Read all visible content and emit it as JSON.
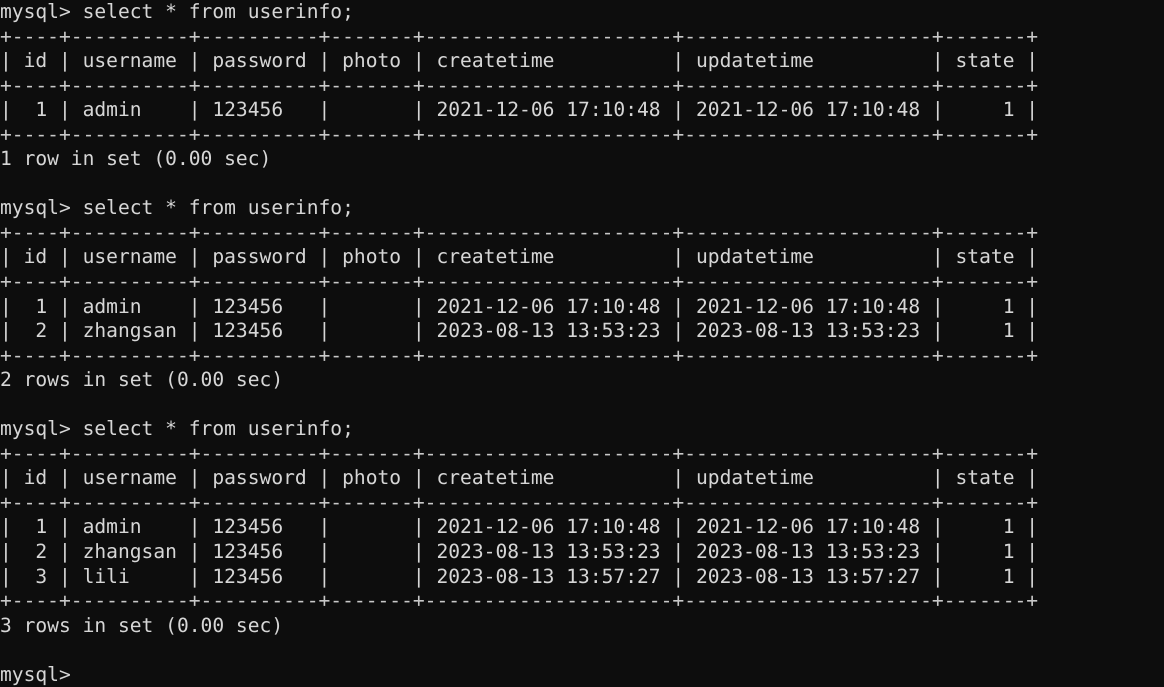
{
  "terminal": {
    "background_color": "#0d0d0d",
    "text_color": "#d6d6d6",
    "rule_color": "#c8c8c8",
    "prompt": "mysql>",
    "final_prompt": "mysql>"
  },
  "table": {
    "name": "userinfo",
    "columns": [
      {
        "label": "id",
        "width": 4,
        "align": "right"
      },
      {
        "label": "username",
        "width": 10,
        "align": "left"
      },
      {
        "label": "password",
        "width": 10,
        "align": "left"
      },
      {
        "label": "photo",
        "width": 7,
        "align": "left"
      },
      {
        "label": "createtime",
        "width": 21,
        "align": "left"
      },
      {
        "label": "updatetime",
        "width": 21,
        "align": "left"
      },
      {
        "label": "state",
        "width": 7,
        "align": "right"
      }
    ]
  },
  "rows": {
    "r1": {
      "id": "1",
      "username": "admin",
      "password": "123456",
      "photo": "",
      "createtime": "2021-12-06 17:10:48",
      "updatetime": "2021-12-06 17:10:48",
      "state": "1"
    },
    "r2": {
      "id": "2",
      "username": "zhangsan",
      "password": "123456",
      "photo": "",
      "createtime": "2023-08-13 13:53:23",
      "updatetime": "2023-08-13 13:53:23",
      "state": "1"
    },
    "r3": {
      "id": "3",
      "username": "lili",
      "password": "123456",
      "photo": "",
      "createtime": "2023-08-13 13:57:27",
      "updatetime": "2023-08-13 13:57:27",
      "state": "1"
    }
  },
  "blocks": [
    {
      "command": "select * from userinfo;",
      "row_keys": [
        "r1"
      ],
      "status": "1 row in set (0.00 sec)"
    },
    {
      "command": "select * from userinfo;",
      "row_keys": [
        "r1",
        "r2"
      ],
      "status": "2 rows in set (0.00 sec)"
    },
    {
      "command": "select * from userinfo;",
      "row_keys": [
        "r1",
        "r2",
        "r3"
      ],
      "status": "3 rows in set (0.00 sec)"
    }
  ]
}
